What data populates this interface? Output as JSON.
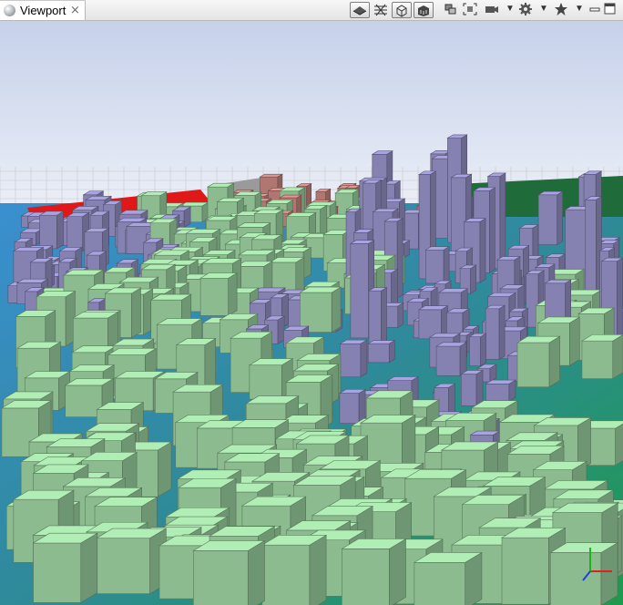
{
  "tab": {
    "label": "Viewport",
    "close_glyph": "⨯"
  },
  "toolbar": {
    "view_modes": [
      "solid-view-icon",
      "wireframe-view-icon",
      "box-view-icon",
      "textured-view-icon"
    ],
    "actions": [
      "layers-icon",
      "frame-selection-icon",
      "camera-icon",
      "settings-icon",
      "bookmark-star-icon"
    ],
    "window": {
      "minimize": "minimize-icon",
      "maximize": "maximize-icon"
    }
  },
  "colors": {
    "sky_top": "#c7d1ea",
    "building_green": "#a3dca8",
    "building_purple": "#9c98cf",
    "building_red": "#cf8c86",
    "terrain_blue": "#2e76b6",
    "terrain_green": "#1e8a4a",
    "highlight_red": "#e02020"
  },
  "axis_gizmo": {
    "x": "red",
    "y": "green",
    "z": "blue"
  }
}
